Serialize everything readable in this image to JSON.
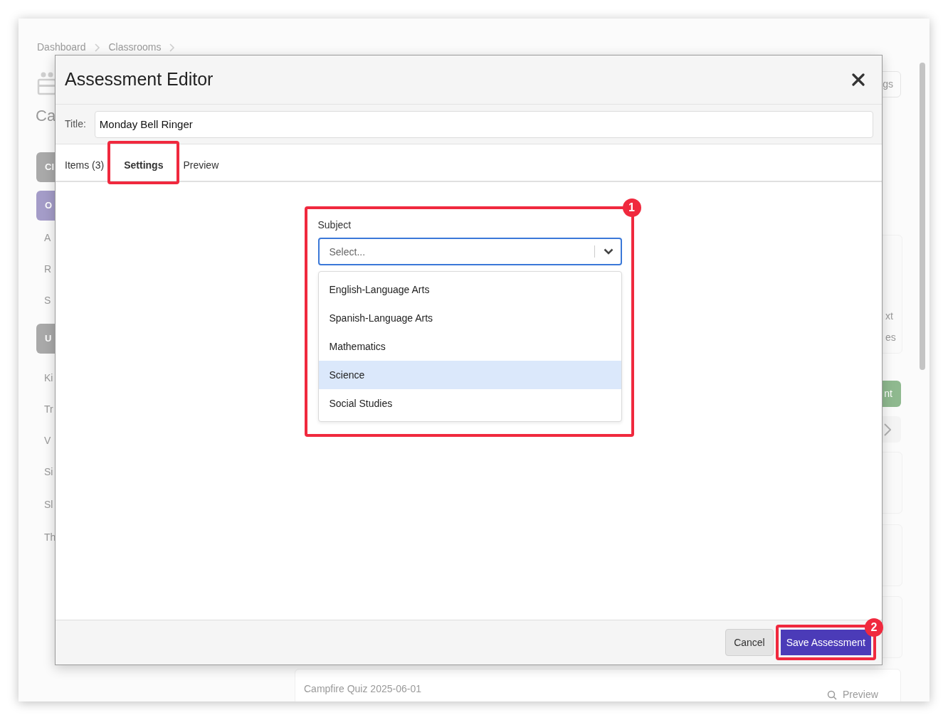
{
  "background": {
    "breadcrumbs": [
      "Dashboard",
      "Classrooms"
    ],
    "heading": "Ca",
    "sidebar": [
      {
        "label": "Cl",
        "kind": "button",
        "color": "#a9a9a9"
      },
      {
        "label": "O",
        "kind": "button",
        "color": "#a49cc8"
      },
      {
        "label": "A",
        "kind": "link"
      },
      {
        "label": "R",
        "kind": "link"
      },
      {
        "label": "S",
        "kind": "link"
      },
      {
        "label": "U",
        "kind": "button",
        "color": "#a9a9a9"
      },
      {
        "label": "Ki",
        "kind": "link"
      },
      {
        "label": "Tr",
        "kind": "link"
      },
      {
        "label": "V",
        "kind": "link"
      },
      {
        "label": "Si",
        "kind": "link"
      },
      {
        "label": "Sl",
        "kind": "link"
      },
      {
        "label": "Th",
        "kind": "link"
      }
    ],
    "right": {
      "top_button": "gs",
      "card_lines": [
        "xt",
        "es"
      ],
      "green_button": "nt"
    },
    "bottom_card": {
      "title": "Campfire Quiz 2025-06-01",
      "action": "Preview"
    }
  },
  "modal": {
    "title": "Assessment Editor",
    "title_label": "Title:",
    "title_value": "Monday Bell Ringer",
    "tabs": [
      {
        "label": "Items (3)",
        "selected": false
      },
      {
        "label": "Settings",
        "selected": true,
        "annotated": true
      },
      {
        "label": "Preview",
        "selected": false
      }
    ],
    "subject": {
      "label": "Subject",
      "placeholder": "Select...",
      "annotation": "1",
      "options": [
        {
          "label": "English-Language Arts",
          "selected": false
        },
        {
          "label": "Spanish-Language Arts",
          "selected": false
        },
        {
          "label": "Mathematics",
          "selected": false
        },
        {
          "label": "Science",
          "selected": true
        },
        {
          "label": "Social Studies",
          "selected": false
        }
      ]
    },
    "buttons": [
      {
        "label": "Cancel",
        "kind": "secondary"
      },
      {
        "label": "Save Assessment",
        "kind": "primary",
        "annotation": "2"
      }
    ]
  }
}
